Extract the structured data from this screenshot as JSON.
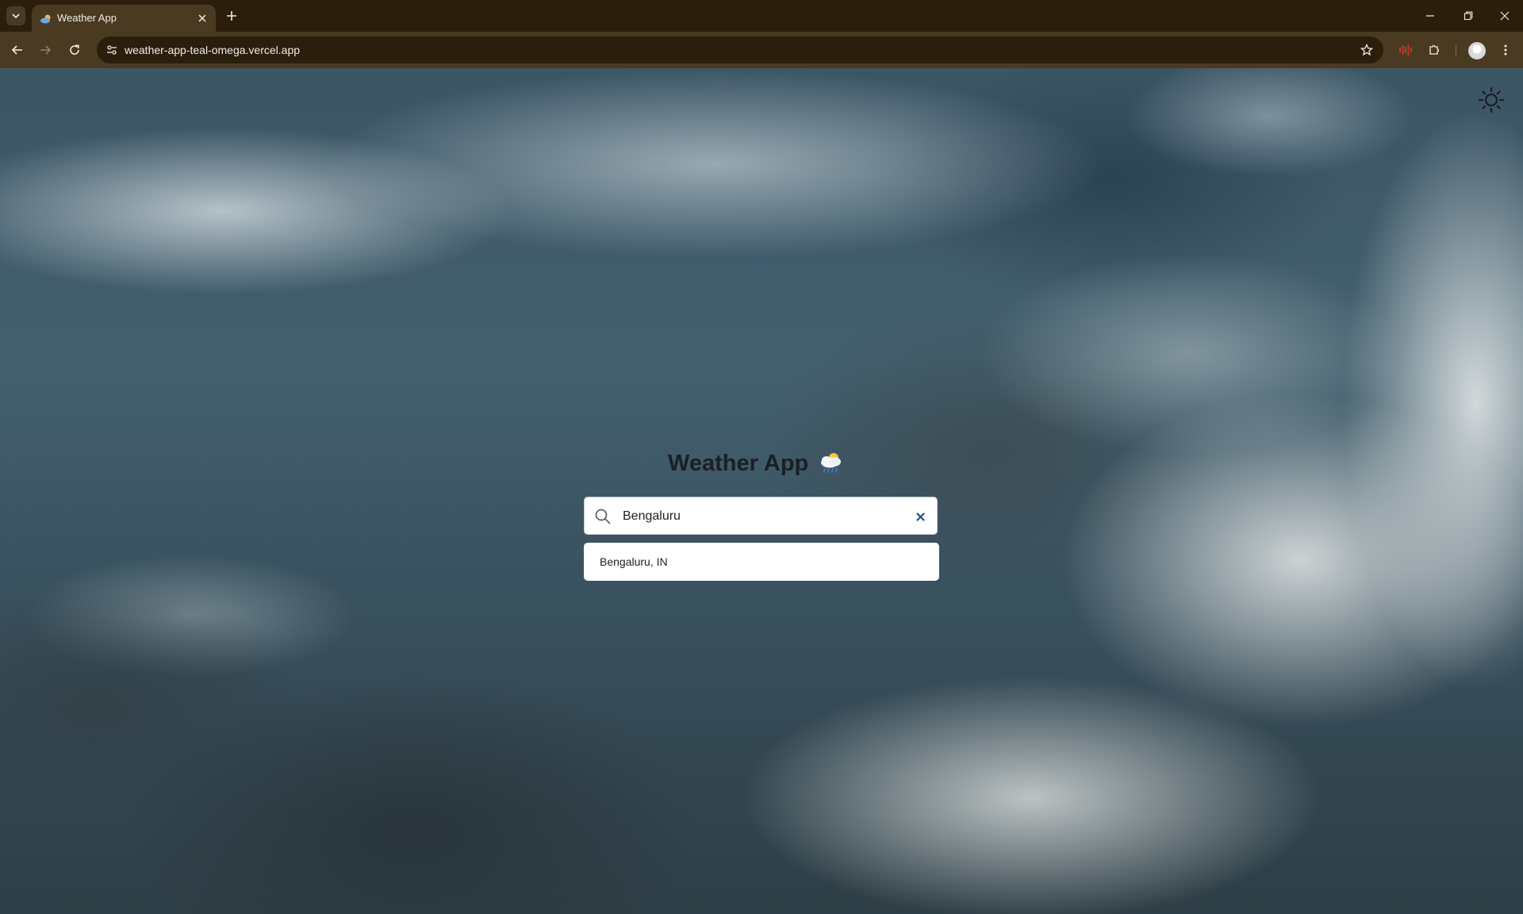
{
  "browser": {
    "tab": {
      "title": "Weather App"
    },
    "address_bar": {
      "url": "weather-app-teal-omega.vercel.app"
    },
    "icons": {
      "tab_search": "chevron-down-icon",
      "tab_close": "close-icon",
      "new_tab": "plus-icon",
      "back": "arrow-left-icon",
      "forward": "arrow-right-icon",
      "reload": "reload-icon",
      "site_info": "tune-icon",
      "bookmark": "star-icon",
      "extension_audio": "audio-bars-icon",
      "extensions": "puzzle-icon",
      "profile": "avatar",
      "menu": "kebab-menu-icon",
      "minimize": "minimize-icon",
      "maximize": "restore-icon",
      "close_window": "close-icon"
    },
    "colors": {
      "frame": "#2b1f0c",
      "toolbar": "#4a3a22"
    }
  },
  "page": {
    "title": "Weather App",
    "title_emoji": "cloud-rain-icon",
    "theme_toggle_icon": "sun-icon",
    "search": {
      "value": "Bengaluru",
      "icon": "search-icon",
      "clear_icon": "close-icon"
    },
    "suggestions": [
      {
        "label": "Bengaluru, IN"
      }
    ],
    "colors": {
      "title_text": "#1a1f24",
      "clear_button": "#1f4f8f"
    }
  }
}
